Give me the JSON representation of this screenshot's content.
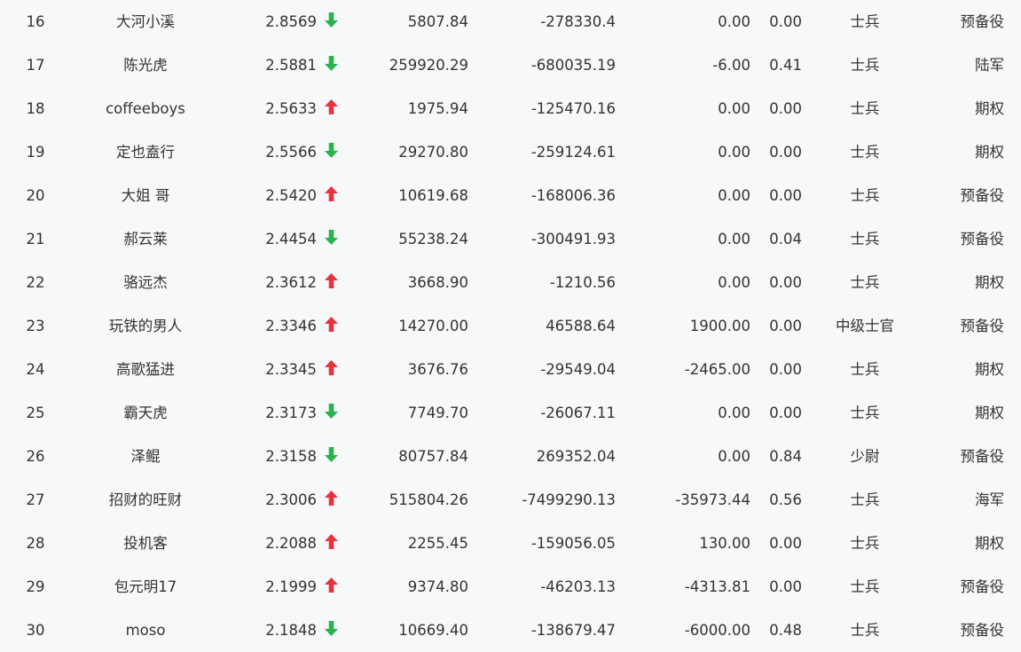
{
  "colors": {
    "up": "#e8323c",
    "down": "#2bb24c",
    "text": "#333333",
    "background": "#f7f8fa"
  },
  "rows": [
    {
      "rank": "16",
      "name": "大河小溪",
      "score": "2.8569",
      "trend": "down",
      "v1": "5807.84",
      "v2": "-278330.4",
      "v3": "0.00",
      "v4": "0.00",
      "level": "士兵",
      "type": "预备役"
    },
    {
      "rank": "17",
      "name": "陈光虎",
      "score": "2.5881",
      "trend": "down",
      "v1": "259920.29",
      "v2": "-680035.19",
      "v3": "-6.00",
      "v4": "0.41",
      "level": "士兵",
      "type": "陆军"
    },
    {
      "rank": "18",
      "name": "coffeeboys",
      "score": "2.5633",
      "trend": "up",
      "v1": "1975.94",
      "v2": "-125470.16",
      "v3": "0.00",
      "v4": "0.00",
      "level": "士兵",
      "type": "期权"
    },
    {
      "rank": "19",
      "name": "定也盍行",
      "score": "2.5566",
      "trend": "down",
      "v1": "29270.80",
      "v2": "-259124.61",
      "v3": "0.00",
      "v4": "0.00",
      "level": "士兵",
      "type": "期权"
    },
    {
      "rank": "20",
      "name": "大姐 哥",
      "score": "2.5420",
      "trend": "up",
      "v1": "10619.68",
      "v2": "-168006.36",
      "v3": "0.00",
      "v4": "0.00",
      "level": "士兵",
      "type": "预备役"
    },
    {
      "rank": "21",
      "name": "郝云莱",
      "score": "2.4454",
      "trend": "down",
      "v1": "55238.24",
      "v2": "-300491.93",
      "v3": "0.00",
      "v4": "0.04",
      "level": "士兵",
      "type": "预备役"
    },
    {
      "rank": "22",
      "name": "骆远杰",
      "score": "2.3612",
      "trend": "up",
      "v1": "3668.90",
      "v2": "-1210.56",
      "v3": "0.00",
      "v4": "0.00",
      "level": "士兵",
      "type": "期权"
    },
    {
      "rank": "23",
      "name": "玩铁的男人",
      "score": "2.3346",
      "trend": "up",
      "v1": "14270.00",
      "v2": "46588.64",
      "v3": "1900.00",
      "v4": "0.00",
      "level": "中级士官",
      "type": "预备役"
    },
    {
      "rank": "24",
      "name": "高歌猛进",
      "score": "2.3345",
      "trend": "up",
      "v1": "3676.76",
      "v2": "-29549.04",
      "v3": "-2465.00",
      "v4": "0.00",
      "level": "士兵",
      "type": "期权"
    },
    {
      "rank": "25",
      "name": "霸天虎",
      "score": "2.3173",
      "trend": "down",
      "v1": "7749.70",
      "v2": "-26067.11",
      "v3": "0.00",
      "v4": "0.00",
      "level": "士兵",
      "type": "期权"
    },
    {
      "rank": "26",
      "name": "泽鲲",
      "score": "2.3158",
      "trend": "down",
      "v1": "80757.84",
      "v2": "269352.04",
      "v3": "0.00",
      "v4": "0.84",
      "level": "少尉",
      "type": "预备役"
    },
    {
      "rank": "27",
      "name": "招财的旺财",
      "score": "2.3006",
      "trend": "up",
      "v1": "515804.26",
      "v2": "-7499290.13",
      "v3": "-35973.44",
      "v4": "0.56",
      "level": "士兵",
      "type": "海军"
    },
    {
      "rank": "28",
      "name": "投机客",
      "score": "2.2088",
      "trend": "up",
      "v1": "2255.45",
      "v2": "-159056.05",
      "v3": "130.00",
      "v4": "0.00",
      "level": "士兵",
      "type": "期权"
    },
    {
      "rank": "29",
      "name": "包元明17",
      "score": "2.1999",
      "trend": "up",
      "v1": "9374.80",
      "v2": "-46203.13",
      "v3": "-4313.81",
      "v4": "0.00",
      "level": "士兵",
      "type": "预备役"
    },
    {
      "rank": "30",
      "name": "moso",
      "score": "2.1848",
      "trend": "down",
      "v1": "10669.40",
      "v2": "-138679.47",
      "v3": "-6000.00",
      "v4": "0.48",
      "level": "士兵",
      "type": "预备役"
    }
  ]
}
